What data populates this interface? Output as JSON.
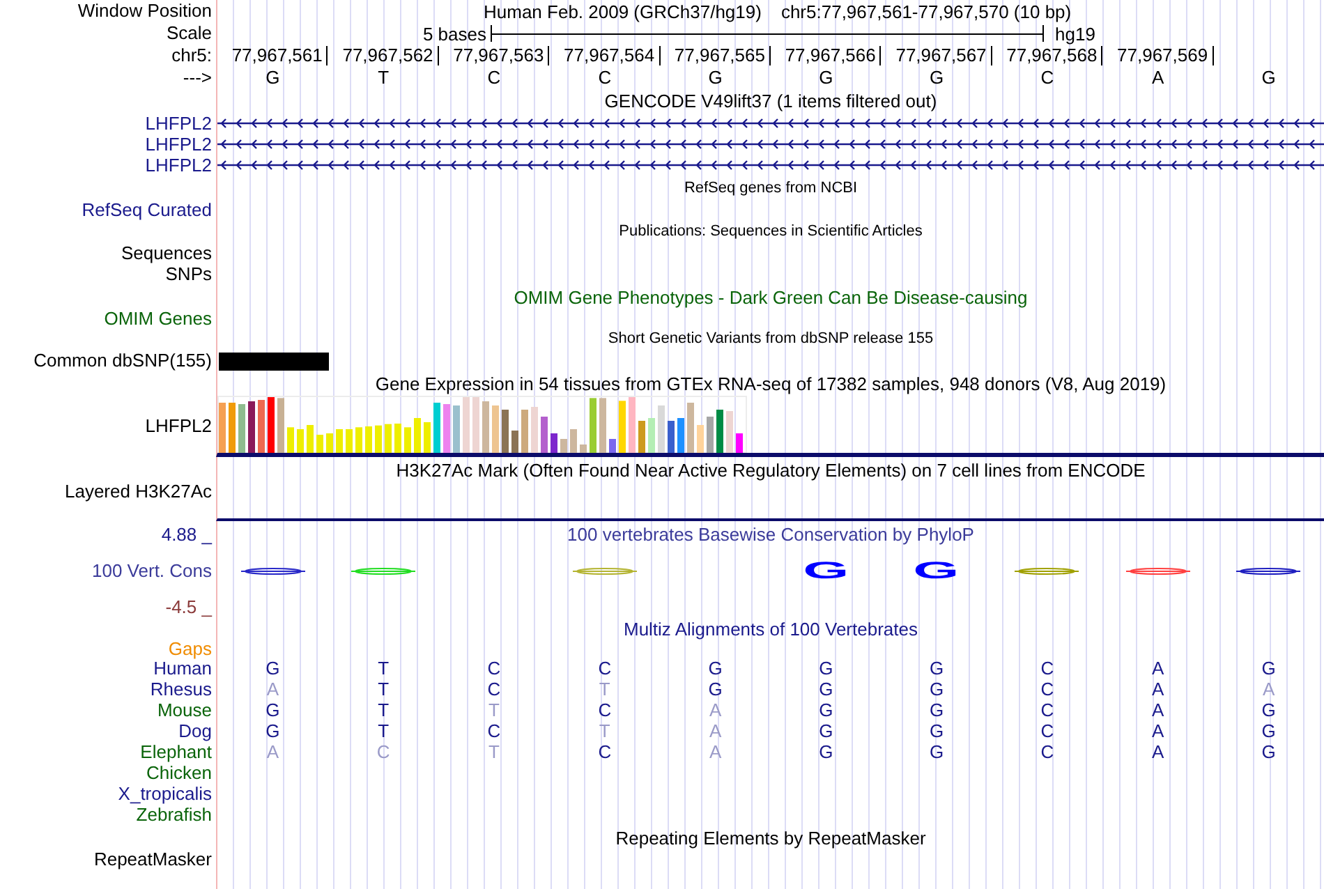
{
  "header": {
    "label": "Window Position",
    "title": "Human Feb. 2009 (GRCh37/hg19)",
    "position": "chr5:77,967,561-77,967,570 (10 bp)"
  },
  "scale": {
    "label": "Scale",
    "span": "5 bases",
    "assembly": "hg19"
  },
  "ruler": {
    "label": "chr5:",
    "positions": [
      "77,967,561",
      "77,967,562",
      "77,967,563",
      "77,967,564",
      "77,967,565",
      "77,967,566",
      "77,967,567",
      "77,967,568",
      "77,967,569"
    ]
  },
  "sequence": {
    "label": "--->",
    "bases": [
      "G",
      "T",
      "C",
      "C",
      "G",
      "G",
      "G",
      "C",
      "A",
      "G"
    ]
  },
  "gencode": {
    "title": "GENCODE V49lift37 (1 items filtered out)",
    "genes": [
      "LHFPL2",
      "LHFPL2",
      "LHFPL2"
    ]
  },
  "refseq": {
    "title": "RefSeq genes from NCBI",
    "label": "RefSeq Curated"
  },
  "publications": {
    "title": "Publications: Sequences in Scientific Articles",
    "labels": [
      "Sequences",
      "SNPs"
    ]
  },
  "omim": {
    "title": "OMIM Gene Phenotypes - Dark Green Can Be Disease-causing",
    "label": "OMIM Genes"
  },
  "dbsnp": {
    "title": "Short Genetic Variants from dbSNP release 155",
    "label": "Common dbSNP(155)"
  },
  "gtex": {
    "title": "Gene Expression in 54 tissues from GTEx RNA-seq of 17382 samples, 948 donors (V8, Aug 2019)",
    "gene": "LHFPL2"
  },
  "h3k27ac": {
    "title": "H3K27Ac Mark (Often Found Near Active Regulatory Elements) on 7 cell lines from ENCODE",
    "label": "Layered H3K27Ac"
  },
  "phylop": {
    "title": "100 vertebrates Basewise Conservation by PhyloP",
    "label": "100 Vert. Cons",
    "max": "4.88 _",
    "min": "-4.5 _",
    "logo": [
      {
        "kind": "flat",
        "color": "#2828c8"
      },
      {
        "kind": "flat",
        "color": "#22dd22"
      },
      {
        "kind": "none"
      },
      {
        "kind": "flat",
        "color": "#b4b432"
      },
      {
        "kind": "none"
      },
      {
        "kind": "tall",
        "letter": "G",
        "color": "#0000ff"
      },
      {
        "kind": "tall",
        "letter": "G",
        "color": "#0000ff"
      },
      {
        "kind": "flat",
        "color": "#a0a000"
      },
      {
        "kind": "flat",
        "color": "#ff4040"
      },
      {
        "kind": "flat",
        "color": "#2020c0"
      }
    ]
  },
  "multiz": {
    "title": "Multiz Alignments of 100 Vertebrates",
    "gaps_label": "Gaps",
    "species": [
      {
        "name": "Human",
        "color": "#1a1a8c",
        "bases": [
          {
            "base": "G",
            "match": true
          },
          {
            "base": "T",
            "match": true
          },
          {
            "base": "C",
            "match": true
          },
          {
            "base": "C",
            "match": true
          },
          {
            "base": "G",
            "match": true
          },
          {
            "base": "G",
            "match": true
          },
          {
            "base": "G",
            "match": true
          },
          {
            "base": "C",
            "match": true
          },
          {
            "base": "A",
            "match": true
          },
          {
            "base": "G",
            "match": true
          }
        ]
      },
      {
        "name": "Rhesus",
        "color": "#1a1a8c",
        "bases": [
          {
            "base": "A",
            "match": false
          },
          {
            "base": "T",
            "match": true
          },
          {
            "base": "C",
            "match": true
          },
          {
            "base": "T",
            "match": false
          },
          {
            "base": "G",
            "match": true
          },
          {
            "base": "G",
            "match": true
          },
          {
            "base": "G",
            "match": true
          },
          {
            "base": "C",
            "match": true
          },
          {
            "base": "A",
            "match": true
          },
          {
            "base": "A",
            "match": false
          }
        ]
      },
      {
        "name": "Mouse",
        "color": "#0a640a",
        "bases": [
          {
            "base": "G",
            "match": true
          },
          {
            "base": "T",
            "match": true
          },
          {
            "base": "T",
            "match": false
          },
          {
            "base": "C",
            "match": true
          },
          {
            "base": "A",
            "match": false
          },
          {
            "base": "G",
            "match": true
          },
          {
            "base": "G",
            "match": true
          },
          {
            "base": "C",
            "match": true
          },
          {
            "base": "A",
            "match": true
          },
          {
            "base": "G",
            "match": true
          }
        ]
      },
      {
        "name": "Dog",
        "color": "#1a1a8c",
        "bases": [
          {
            "base": "G",
            "match": true
          },
          {
            "base": "T",
            "match": true
          },
          {
            "base": "C",
            "match": true
          },
          {
            "base": "T",
            "match": false
          },
          {
            "base": "A",
            "match": false
          },
          {
            "base": "G",
            "match": true
          },
          {
            "base": "G",
            "match": true
          },
          {
            "base": "C",
            "match": true
          },
          {
            "base": "A",
            "match": true
          },
          {
            "base": "G",
            "match": true
          }
        ]
      },
      {
        "name": "Elephant",
        "color": "#0a640a",
        "bases": [
          {
            "base": "A",
            "match": false
          },
          {
            "base": "C",
            "match": false
          },
          {
            "base": "T",
            "match": false
          },
          {
            "base": "C",
            "match": true
          },
          {
            "base": "A",
            "match": false
          },
          {
            "base": "G",
            "match": true
          },
          {
            "base": "G",
            "match": true
          },
          {
            "base": "C",
            "match": true
          },
          {
            "base": "A",
            "match": true
          },
          {
            "base": "G",
            "match": true
          }
        ]
      },
      {
        "name": "Chicken",
        "color": "#0a640a"
      },
      {
        "name": "X_tropicalis",
        "color": "#1a1a8c"
      },
      {
        "name": "Zebrafish",
        "color": "#0a640a"
      }
    ]
  },
  "repeatmasker": {
    "title": "Repeating Elements by RepeatMasker",
    "label": "RepeatMasker"
  }
}
